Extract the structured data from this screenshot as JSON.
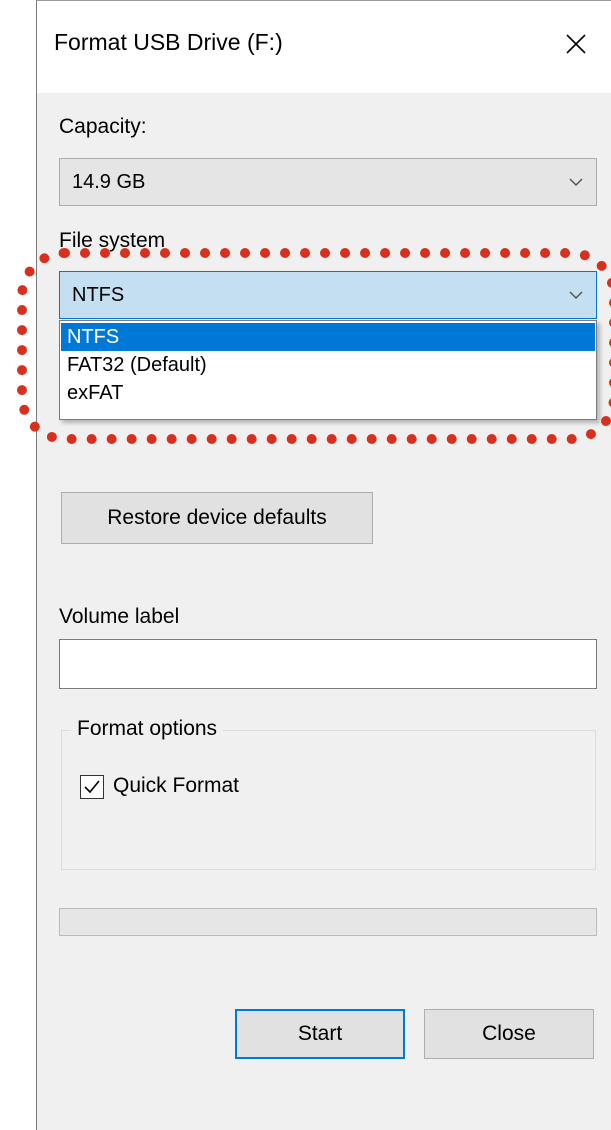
{
  "window": {
    "title": "Format USB Drive (F:)"
  },
  "capacity": {
    "label": "Capacity:",
    "value": "14.9 GB"
  },
  "file_system": {
    "label": "File system",
    "value": "NTFS",
    "options": [
      "NTFS",
      "FAT32 (Default)",
      "exFAT"
    ],
    "selected_index": 0
  },
  "restore_button": {
    "label": "Restore device defaults"
  },
  "volume_label": {
    "label": "Volume label",
    "value": ""
  },
  "format_options": {
    "title": "Format options",
    "quick_format": {
      "label": "Quick Format",
      "checked": true
    }
  },
  "progress": {
    "value": 0
  },
  "buttons": {
    "start": "Start",
    "close": "Close"
  },
  "colors": {
    "highlight": "#d9301e",
    "accent": "#0078d7"
  }
}
